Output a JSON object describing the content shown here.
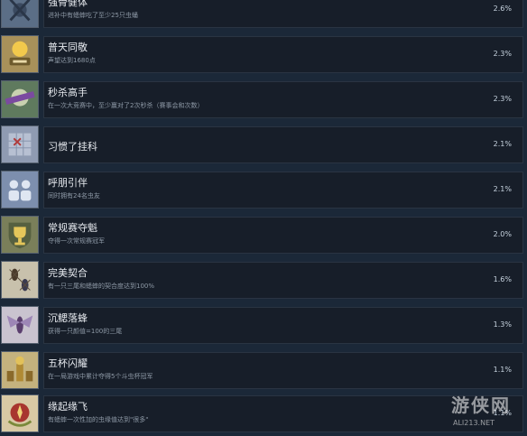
{
  "achievements": [
    {
      "title": "强骨健体",
      "desc": "进补中有蟋蟀吃了至少25只虫蛹",
      "pct": "2.6%",
      "icon": "insect-icon",
      "icon_bg": "#5b6e86"
    },
    {
      "title": "普天同敬",
      "desc": "声望达到1680点",
      "pct": "2.3%",
      "icon": "medal-sun-icon",
      "icon_bg": "#b99a4e"
    },
    {
      "title": "秒杀高手",
      "desc": "在一次大竞赛中，至少赢对了2次秒杀（赛事会和次数）",
      "pct": "2.3%",
      "icon": "bell-ribbon-icon",
      "icon_bg": "#5f7a5e"
    },
    {
      "title": "习惯了挂科",
      "desc": "",
      "pct": "2.1%",
      "icon": "crossed-grid-icon",
      "icon_bg": "#8f9bb2"
    },
    {
      "title": "呼朋引伴",
      "desc": "同时拥有24名虫友",
      "pct": "2.1%",
      "icon": "people-icon",
      "icon_bg": "#7d8fae"
    },
    {
      "title": "常规赛夺魁",
      "desc": "夺得一次常规赛冠军",
      "pct": "2.0%",
      "icon": "trophy-shield-icon",
      "icon_bg": "#7a7f5a"
    },
    {
      "title": "完美契合",
      "desc": "有一只三尾和蟋蟀的契合度达到100%",
      "pct": "1.6%",
      "icon": "crickets-icon",
      "icon_bg": "#c8c1ac"
    },
    {
      "title": "沉鳃落蜂",
      "desc": "获得一只颜值=100的三尾",
      "pct": "1.3%",
      "icon": "winged-insect-icon",
      "icon_bg": "#c9c3cf"
    },
    {
      "title": "五杯闪耀",
      "desc": "在一局游戏中累计夺得5个斗虫杯冠军",
      "pct": "1.1%",
      "icon": "five-cups-icon",
      "icon_bg": "#c4b27e"
    },
    {
      "title": "缘起缘飞",
      "desc": "有蟋蟀一次性加的虫缘值达到\"很多\"",
      "pct": "1.1%",
      "icon": "laurel-emblem-icon",
      "icon_bg": "#d8c9a4"
    }
  ],
  "watermark": {
    "main": "游侠网",
    "sub": "ALI213.NET"
  },
  "colors": {
    "background": "#1b2838",
    "row": "#171e29",
    "text": "#e6e9ee",
    "muted": "#8e99a6"
  }
}
